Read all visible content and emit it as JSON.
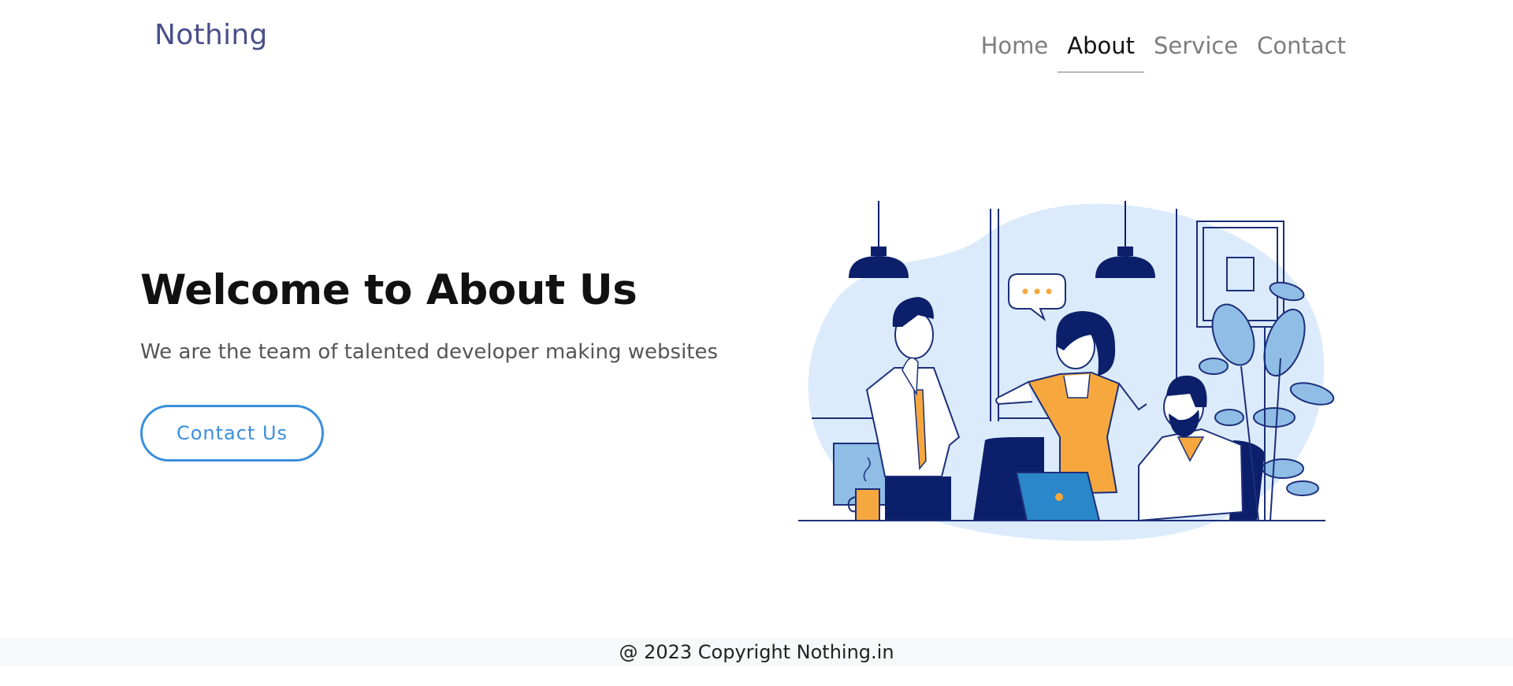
{
  "brand": "Nothing",
  "nav": {
    "items": [
      {
        "label": "Home"
      },
      {
        "label": "About"
      },
      {
        "label": "Service"
      },
      {
        "label": "Contact"
      }
    ],
    "active": "About"
  },
  "hero": {
    "title": "Welcome to About Us",
    "subtitle": "We are the team of talented developer making websites",
    "button_label": "Contact Us",
    "illustration_icon": "team-meeting-illustration"
  },
  "footer": {
    "text": "@ 2023 Copyright Nothing.in"
  },
  "colors": {
    "brand": "#4a4f8c",
    "accent": "#3a8fdc",
    "navy": "#0b1f6b",
    "orange": "#f6a83e",
    "light_blue": "#dcebfb"
  }
}
